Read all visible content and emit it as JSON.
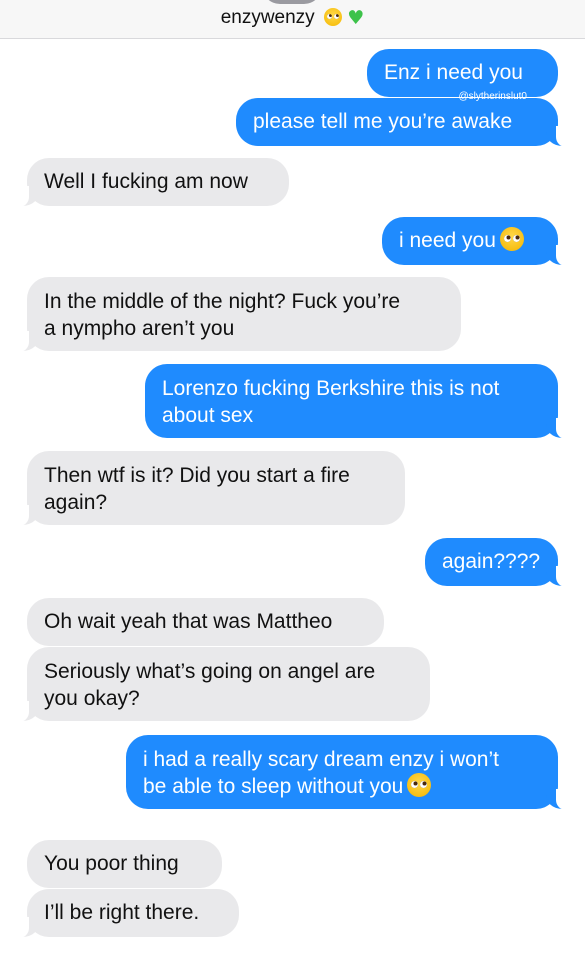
{
  "header": {
    "contact_name": "enzywenzy",
    "emoji_1": "pleading-face-icon",
    "emoji_2": "green-heart-icon"
  },
  "watermark": "@slytherinslut0",
  "colors": {
    "outgoing_bubble": "#1f8bfe",
    "incoming_bubble": "#e9e9eb",
    "background": "#ffffff"
  },
  "messages": [
    {
      "from": "me",
      "lines": [
        "Enz i need you"
      ]
    },
    {
      "from": "me",
      "lines": [
        "please tell me you’re awake"
      ]
    },
    {
      "from": "them",
      "lines": [
        "Well I fucking am now"
      ]
    },
    {
      "from": "me",
      "lines": [
        "i need you"
      ],
      "emoji": "pleading-face-icon"
    },
    {
      "from": "them",
      "lines": [
        "In the middle of the night? Fuck you’re",
        "a nympho aren’t you"
      ]
    },
    {
      "from": "me",
      "lines": [
        "Lorenzo fucking Berkshire this is not",
        "about sex"
      ]
    },
    {
      "from": "them",
      "lines": [
        "Then wtf is it? Did you start a fire",
        "again?"
      ]
    },
    {
      "from": "me",
      "lines": [
        "again????"
      ]
    },
    {
      "from": "them",
      "lines": [
        "Oh wait yeah that was Mattheo"
      ]
    },
    {
      "from": "them",
      "lines": [
        "Seriously what’s going on angel are",
        "you okay?"
      ]
    },
    {
      "from": "me",
      "lines": [
        "i had a really scary dream enzy i won’t",
        "be able to sleep without you"
      ],
      "emoji": "pleading-face-icon"
    },
    {
      "from": "them",
      "lines": [
        "You poor thing"
      ]
    },
    {
      "from": "them",
      "lines": [
        "I’ll be right there."
      ]
    }
  ]
}
